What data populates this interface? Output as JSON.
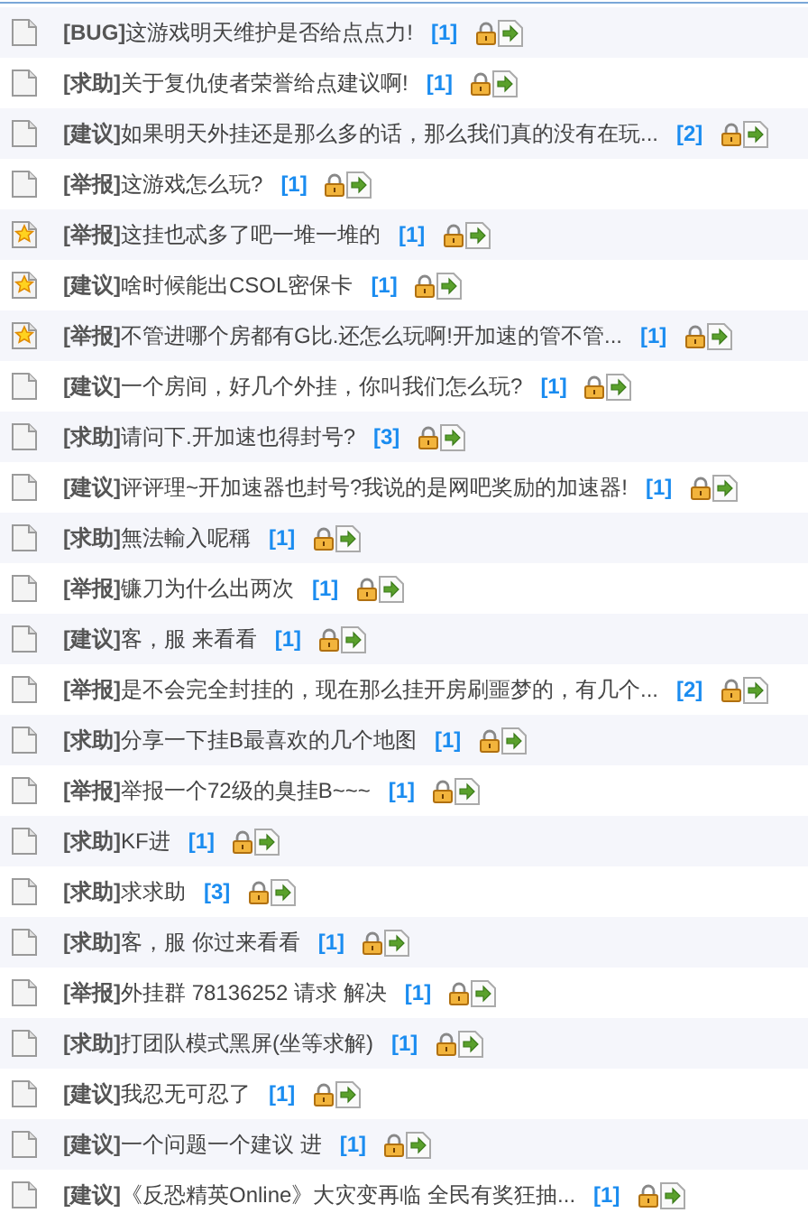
{
  "threads": [
    {
      "kind": "plain",
      "tag": "[BUG]",
      "title": "这游戏明天维护是否给点点力!",
      "replies": "[1]"
    },
    {
      "kind": "plain",
      "tag": "[求助]",
      "title": "关于复仇使者荣誉给点建议啊!",
      "replies": "[1]"
    },
    {
      "kind": "plain",
      "tag": "[建议]",
      "title": "如果明天外挂还是那么多的话，那么我们真的没有在玩...",
      "replies": "[2]"
    },
    {
      "kind": "plain",
      "tag": "[举报]",
      "title": "这游戏怎么玩?",
      "replies": "[1]"
    },
    {
      "kind": "starred",
      "tag": "[举报]",
      "title": "这挂也忒多了吧一堆一堆的",
      "replies": "[1]"
    },
    {
      "kind": "starred",
      "tag": "[建议]",
      "title": "啥时候能出CSOL密保卡",
      "replies": "[1]"
    },
    {
      "kind": "starred",
      "tag": "[举报]",
      "title": "不管进哪个房都有G比.还怎么玩啊!开加速的管不管...",
      "replies": "[1]"
    },
    {
      "kind": "plain",
      "tag": "[建议]",
      "title": "一个房间，好几个外挂，你叫我们怎么玩?",
      "replies": "[1]"
    },
    {
      "kind": "plain",
      "tag": "[求助]",
      "title": "请问下.开加速也得封号?",
      "replies": "[3]"
    },
    {
      "kind": "plain",
      "tag": "[建议]",
      "title": "评评理~开加速器也封号?我说的是网吧奖励的加速器!",
      "replies": "[1]"
    },
    {
      "kind": "plain",
      "tag": "[求助]",
      "title": "無法輸入呢稱",
      "replies": "[1]"
    },
    {
      "kind": "plain",
      "tag": "[举报]",
      "title": "镰刀为什么出两次",
      "replies": "[1]"
    },
    {
      "kind": "plain",
      "tag": "[建议]",
      "title": "客，服 来看看",
      "replies": "[1]"
    },
    {
      "kind": "plain",
      "tag": "[举报]",
      "title": "是不会完全封挂的，现在那么挂开房刷噩梦的，有几个...",
      "replies": "[2]"
    },
    {
      "kind": "plain",
      "tag": "[求助]",
      "title": "分享一下挂B最喜欢的几个地图",
      "replies": "[1]"
    },
    {
      "kind": "plain",
      "tag": "[举报]",
      "title": "举报一个72级的臭挂B~~~",
      "replies": "[1]"
    },
    {
      "kind": "plain",
      "tag": "[求助]",
      "title": "KF进",
      "replies": "[1]"
    },
    {
      "kind": "plain",
      "tag": "[求助]",
      "title": "求求助",
      "replies": "[3]"
    },
    {
      "kind": "plain",
      "tag": "[求助]",
      "title": "客，服 你过来看看",
      "replies": "[1]"
    },
    {
      "kind": "plain",
      "tag": "[举报]",
      "title": "外挂群 78136252 请求 解决",
      "replies": "[1]"
    },
    {
      "kind": "plain",
      "tag": "[求助]",
      "title": "打团队模式黑屏(坐等求解)",
      "replies": "[1]"
    },
    {
      "kind": "plain",
      "tag": "[建议]",
      "title": "我忍无可忍了",
      "replies": "[1]"
    },
    {
      "kind": "plain",
      "tag": "[建议]",
      "title": "一个问题一个建议 进",
      "replies": "[1]"
    },
    {
      "kind": "plain",
      "tag": "[建议]",
      "title": "《反恐精英Online》大灾变再临 全民有奖狂抽...",
      "replies": "[1]"
    }
  ]
}
